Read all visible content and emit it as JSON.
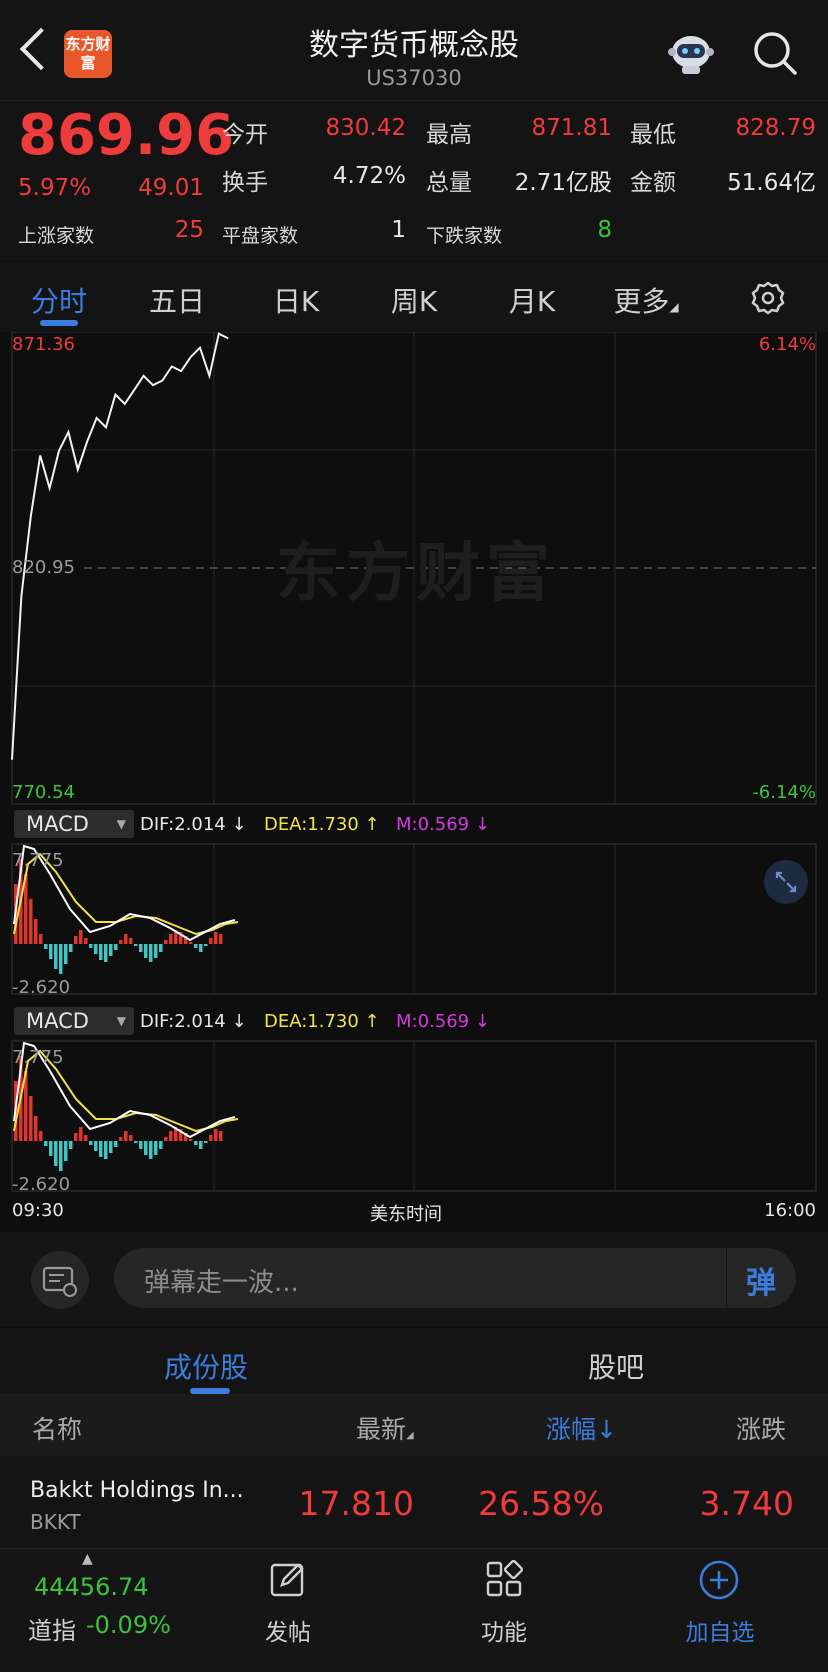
{
  "header": {
    "logo_text": "东方财富",
    "title": "数字货币概念股",
    "subtitle": "US37030"
  },
  "quote": {
    "price": "869.96",
    "change_pct": "5.97%",
    "change_abs": "49.01",
    "open_label": "今开",
    "open_value": "830.42",
    "high_label": "最高",
    "high_value": "871.81",
    "low_label": "最低",
    "low_value": "828.79",
    "turnover_label": "换手",
    "turnover_value": "4.72%",
    "volume_label": "总量",
    "volume_value": "2.71亿股",
    "amount_label": "金额",
    "amount_value": "51.64亿",
    "up_count_label": "上涨家数",
    "up_count": "25",
    "flat_count_label": "平盘家数",
    "flat_count": "1",
    "down_count_label": "下跌家数",
    "down_count": "8"
  },
  "tabs": [
    "分时",
    "五日",
    "日K",
    "周K",
    "月K",
    "更多"
  ],
  "chart": {
    "price_top": "871.36",
    "price_mid": "820.95",
    "price_bottom": "770.54",
    "pct_top": "6.14%",
    "pct_bottom": "-6.14%",
    "watermark": "东方财富",
    "x_start": "09:30",
    "x_mid": "美东时间",
    "x_end": "16:00"
  },
  "macd": {
    "pill_label": "MACD",
    "dif": "DIF:2.014 ↓",
    "dea": "DEA:1.730 ↑",
    "m": "M:0.569 ↓",
    "y_top": "7.775",
    "y_bottom": "-2.620"
  },
  "comment": {
    "placeholder": "弹幕走一波...",
    "danmu_label": "弹"
  },
  "list": {
    "tab_components": "成份股",
    "tab_forum": "股吧",
    "col_name": "名称",
    "col_latest": "最新",
    "col_pct": "涨幅↓",
    "col_change": "涨跌",
    "rows": [
      {
        "name": "Bakkt Holdings In...",
        "code": "BKKT",
        "latest": "17.810",
        "pct": "26.58%",
        "change": "3.740"
      }
    ]
  },
  "bottomnav": {
    "index_value": "44456.74",
    "index_label": "道指",
    "index_change": "-0.09%",
    "post_label": "发帖",
    "func_label": "功能",
    "add_label": "加自选"
  },
  "colors": {
    "up": "#ee3b3b",
    "down": "#3ec23e",
    "accent": "#3b7cdc",
    "dea": "#f2e24a",
    "m": "#d63adf"
  },
  "chart_data": {
    "type": "line",
    "title": "",
    "series": [
      {
        "values": [
          780,
          815,
          832,
          845,
          838,
          846,
          850,
          842,
          848,
          853,
          851,
          858,
          856,
          859,
          862,
          860,
          861,
          864,
          863,
          866,
          868,
          862,
          871,
          870
        ]
      }
    ],
    "ylim": [
      770.54,
      871.36
    ],
    "grid": true
  }
}
